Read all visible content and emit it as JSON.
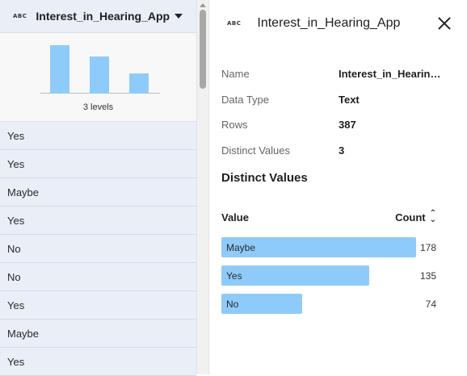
{
  "column": {
    "type_badge": "ABC",
    "name": "Interest_in_Hearing_App",
    "summary_label": "3 levels",
    "mini_bars": [
      178,
      135,
      74
    ]
  },
  "rows": [
    "Yes",
    "Yes",
    "Maybe",
    "Yes",
    "No",
    "No",
    "Yes",
    "Maybe",
    "Yes"
  ],
  "panel": {
    "type_badge": "ABC",
    "title": "Interest_in_Hearing_App",
    "properties": [
      {
        "label": "Name",
        "value": "Interest_in_Hearing_App"
      },
      {
        "label": "Data Type",
        "value": "Text"
      },
      {
        "label": "Rows",
        "value": "387"
      },
      {
        "label": "Distinct Values",
        "value": "3"
      }
    ],
    "distinct_title": "Distinct Values",
    "value_header": "Value",
    "count_header": "Count",
    "distinct": [
      {
        "value": "Maybe",
        "count": 178
      },
      {
        "value": "Yes",
        "count": 135
      },
      {
        "value": "No",
        "count": 74
      }
    ]
  },
  "colors": {
    "bar": "#8fcbfa",
    "row_bg": "#e9eef7"
  }
}
